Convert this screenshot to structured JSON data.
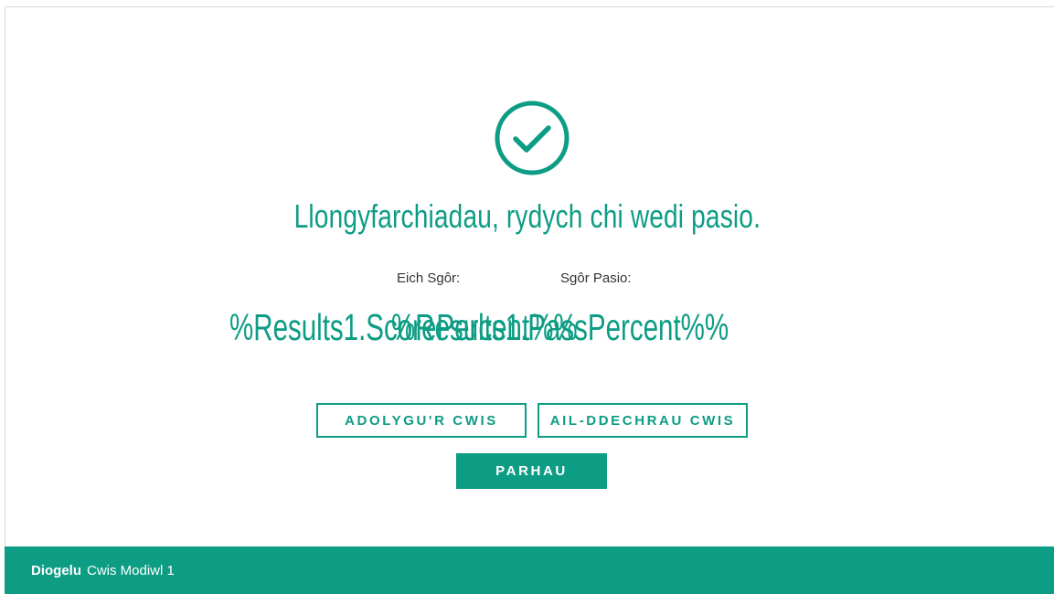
{
  "result": {
    "icon": "check-circle-icon",
    "message": "Llongyfarchiadau, rydych chi wedi pasio.",
    "score_label": "Eich Sgôr:",
    "pass_label": "Sgôr Pasio:",
    "score_value": "%Results1.ScorePercent%%",
    "pass_value": "%Results1.PassPercent%%"
  },
  "buttons": {
    "review": "ADOLYGU'R CWIS",
    "restart": "AIL-DDECHRAU CWIS",
    "continue": "PARHAU"
  },
  "footer": {
    "brand": "Diogelu",
    "course": "Cwis Modiwl 1"
  },
  "colors": {
    "accent": "#0d9c84",
    "text": "#333333",
    "background": "#ffffff"
  }
}
